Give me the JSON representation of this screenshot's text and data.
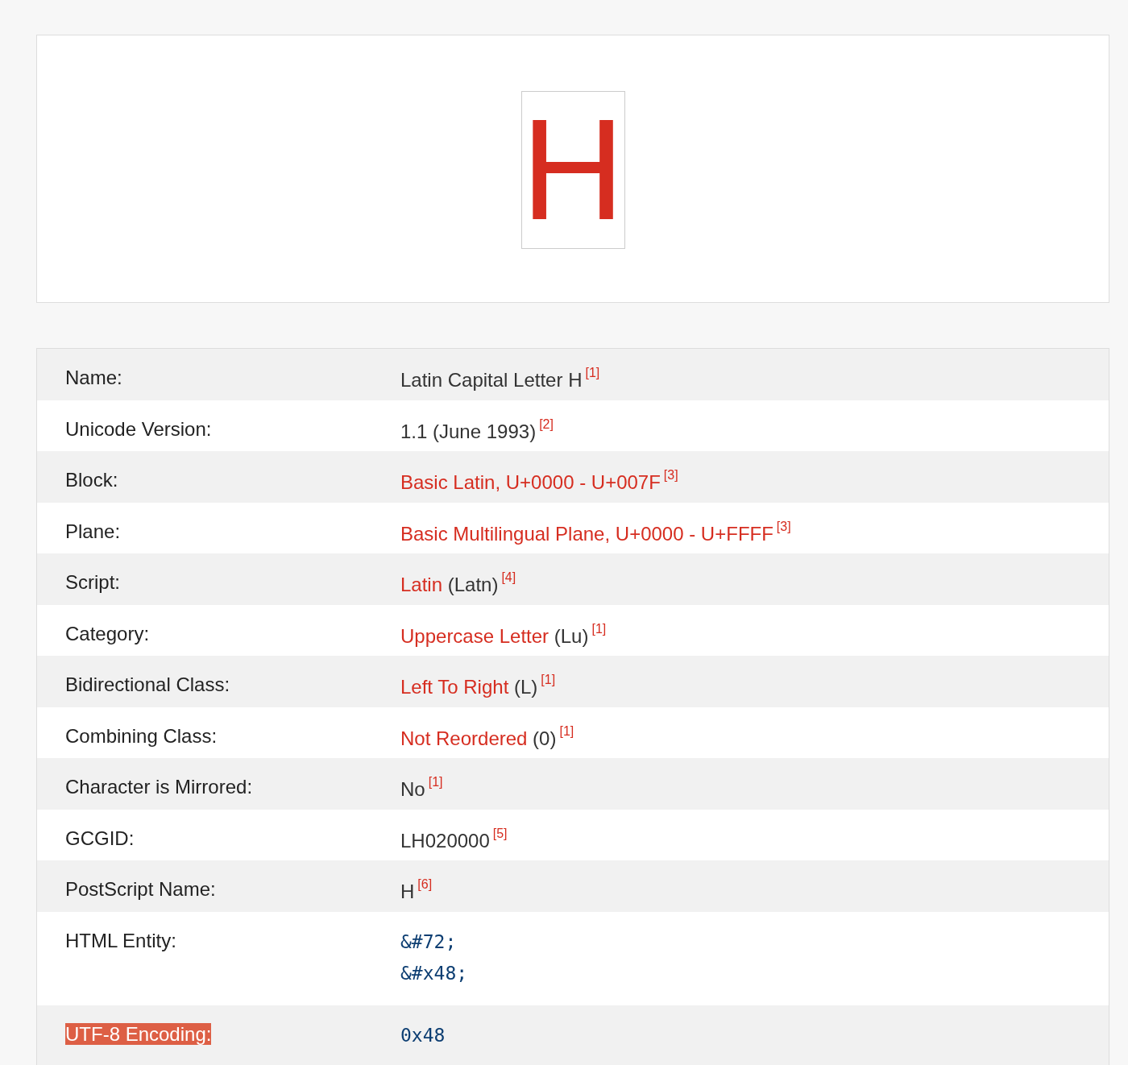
{
  "glyph": {
    "character": "H"
  },
  "properties": [
    {
      "label": "Name:",
      "kind": "text",
      "highlighted": false,
      "value": [
        {
          "text": "Latin Capital Letter H",
          "link": false
        }
      ],
      "ref": "[1]"
    },
    {
      "label": "Unicode Version:",
      "kind": "text",
      "highlighted": false,
      "value": [
        {
          "text": "1.1 (June 1993)",
          "link": false
        }
      ],
      "ref": "[2]"
    },
    {
      "label": "Block:",
      "kind": "text",
      "highlighted": false,
      "value": [
        {
          "text": "Basic Latin, U+0000 - U+007F",
          "link": true
        }
      ],
      "ref": "[3]"
    },
    {
      "label": "Plane:",
      "kind": "text",
      "highlighted": false,
      "value": [
        {
          "text": "Basic Multilingual Plane, U+0000 - U+FFFF",
          "link": true
        }
      ],
      "ref": "[3]"
    },
    {
      "label": "Script:",
      "kind": "text",
      "highlighted": false,
      "value": [
        {
          "text": "Latin",
          "link": true
        },
        {
          "text": "(Latn)",
          "link": false
        }
      ],
      "ref": "[4]"
    },
    {
      "label": "Category:",
      "kind": "text",
      "highlighted": false,
      "value": [
        {
          "text": "Uppercase Letter",
          "link": true
        },
        {
          "text": "(Lu)",
          "link": false
        }
      ],
      "ref": "[1]"
    },
    {
      "label": "Bidirectional Class:",
      "kind": "text",
      "highlighted": false,
      "value": [
        {
          "text": "Left To Right",
          "link": true
        },
        {
          "text": "(L)",
          "link": false
        }
      ],
      "ref": "[1]"
    },
    {
      "label": "Combining Class:",
      "kind": "text",
      "highlighted": false,
      "value": [
        {
          "text": "Not Reordered",
          "link": true
        },
        {
          "text": "(0)",
          "link": false
        }
      ],
      "ref": "[1]"
    },
    {
      "label": "Character is Mirrored:",
      "kind": "text",
      "highlighted": false,
      "value": [
        {
          "text": "No",
          "link": false
        }
      ],
      "ref": "[1]"
    },
    {
      "label": "GCGID:",
      "kind": "text",
      "highlighted": false,
      "value": [
        {
          "text": "LH020000",
          "link": false
        }
      ],
      "ref": "[5]"
    },
    {
      "label": "PostScript Name:",
      "kind": "text",
      "highlighted": false,
      "value": [
        {
          "text": "H",
          "link": false
        }
      ],
      "ref": "[6]"
    },
    {
      "label": "HTML Entity:",
      "kind": "code",
      "highlighted": false,
      "value": [
        {
          "text": "&#72;"
        },
        {
          "text": "&#x48;"
        }
      ]
    },
    {
      "label": "UTF-8 Encoding:",
      "kind": "code",
      "highlighted": true,
      "value": [
        {
          "text": "0x48"
        }
      ]
    }
  ]
}
